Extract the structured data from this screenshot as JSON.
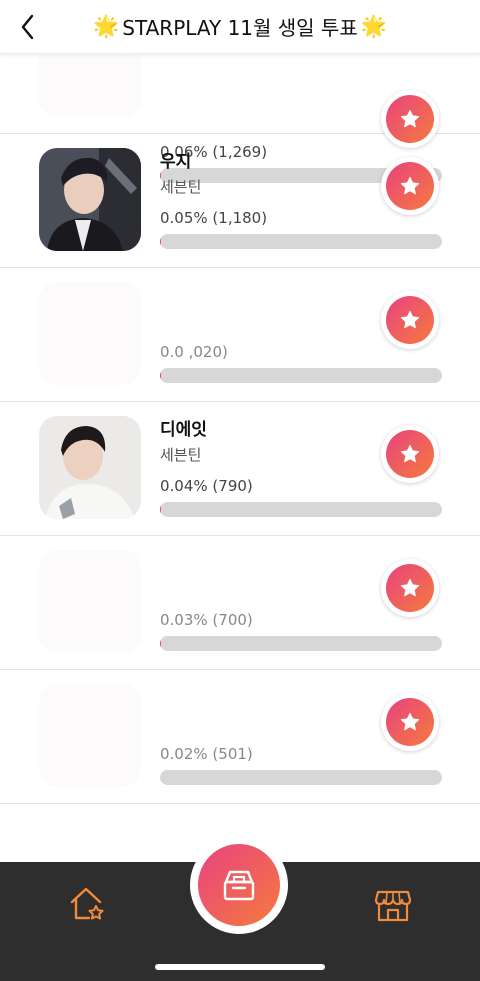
{
  "header": {
    "back_icon": "chevron-left-icon",
    "title_prefix_emoji": "🌟",
    "title": "STARPLAY 11월 생일 투표",
    "title_suffix_emoji": "🌟"
  },
  "colors": {
    "accent_start": "#e8437f",
    "accent_end": "#f57a3d",
    "tabbar_bg": "#2e2e2e",
    "tab_icon": "#f08a3c",
    "bar_track": "#d7d7d7"
  },
  "rows": [
    {
      "name": "",
      "group": "",
      "stat": "0.06% (1,269)",
      "percent": 0.06,
      "avatar": "hidden",
      "vote_icon": "star-icon"
    },
    {
      "name": "우지",
      "group": "세븐틴",
      "stat": "0.05% (1,180)",
      "percent": 0.05,
      "avatar": "photo",
      "vote_icon": "star-icon"
    },
    {
      "name": "",
      "group": "",
      "stat": "0.0   ,020)",
      "percent": 0.04,
      "avatar": "hidden",
      "vote_icon": "star-icon"
    },
    {
      "name": "디에잇",
      "group": "세븐틴",
      "stat": "0.04% (790)",
      "percent": 0.04,
      "avatar": "photo",
      "vote_icon": "star-icon"
    },
    {
      "name": "",
      "group": "",
      "stat": "0.03% (700)",
      "percent": 0.03,
      "avatar": "hidden",
      "vote_icon": "star-icon"
    },
    {
      "name": "",
      "group": "",
      "stat": "0.02% (501)",
      "percent": 0.02,
      "avatar": "hidden",
      "vote_icon": "star-icon"
    }
  ],
  "tabbar": {
    "left_icon": "home-star-icon",
    "center_icon": "ballot-box-icon",
    "right_icon": "store-icon"
  }
}
